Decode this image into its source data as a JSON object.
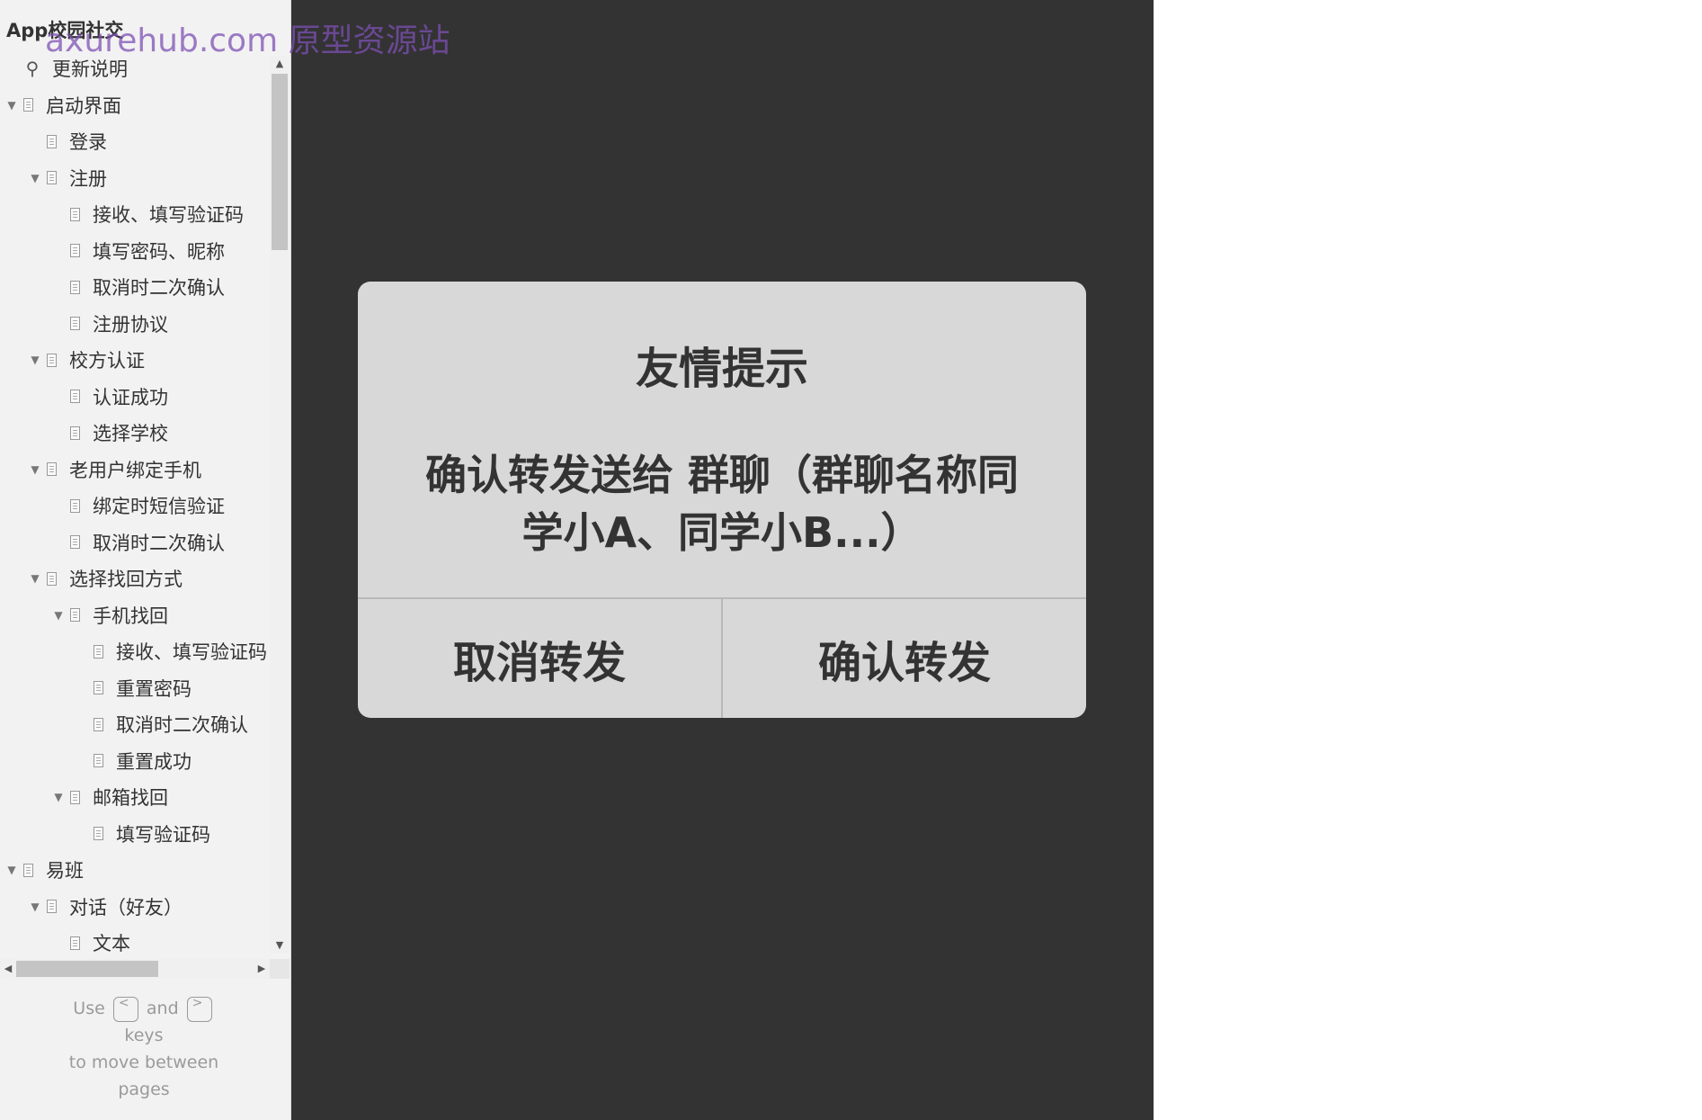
{
  "app": {
    "title": "App校园社交",
    "watermark": "axurehub.com 原型资源站"
  },
  "sidebar": {
    "items": [
      {
        "label": "更新说明",
        "level": 0,
        "expanded": null,
        "icon": "notes-icon"
      },
      {
        "label": "启动界面",
        "level": 0,
        "expanded": true,
        "icon": "page-icon"
      },
      {
        "label": "登录",
        "level": 1,
        "expanded": null,
        "icon": "page-icon"
      },
      {
        "label": "注册",
        "level": 1,
        "expanded": true,
        "icon": "page-icon"
      },
      {
        "label": "接收、填写验证码",
        "level": 2,
        "expanded": null,
        "icon": "page-icon"
      },
      {
        "label": "填写密码、昵称",
        "level": 2,
        "expanded": null,
        "icon": "page-icon"
      },
      {
        "label": "取消时二次确认",
        "level": 2,
        "expanded": null,
        "icon": "page-icon"
      },
      {
        "label": "注册协议",
        "level": 2,
        "expanded": null,
        "icon": "page-icon"
      },
      {
        "label": "校方认证",
        "level": 1,
        "expanded": true,
        "icon": "page-icon"
      },
      {
        "label": "认证成功",
        "level": 2,
        "expanded": null,
        "icon": "page-icon"
      },
      {
        "label": "选择学校",
        "level": 2,
        "expanded": null,
        "icon": "page-icon"
      },
      {
        "label": "老用户绑定手机",
        "level": 1,
        "expanded": true,
        "icon": "page-icon"
      },
      {
        "label": "绑定时短信验证",
        "level": 2,
        "expanded": null,
        "icon": "page-icon"
      },
      {
        "label": "取消时二次确认",
        "level": 2,
        "expanded": null,
        "icon": "page-icon"
      },
      {
        "label": "选择找回方式",
        "level": 1,
        "expanded": true,
        "icon": "page-icon"
      },
      {
        "label": "手机找回",
        "level": 2,
        "expanded": true,
        "icon": "page-icon"
      },
      {
        "label": "接收、填写验证码",
        "level": 3,
        "expanded": null,
        "icon": "page-icon"
      },
      {
        "label": "重置密码",
        "level": 3,
        "expanded": null,
        "icon": "page-icon"
      },
      {
        "label": "取消时二次确认",
        "level": 3,
        "expanded": null,
        "icon": "page-icon"
      },
      {
        "label": "重置成功",
        "level": 3,
        "expanded": null,
        "icon": "page-icon"
      },
      {
        "label": "邮箱找回",
        "level": 2,
        "expanded": true,
        "icon": "page-icon"
      },
      {
        "label": "填写验证码",
        "level": 3,
        "expanded": null,
        "icon": "page-icon"
      },
      {
        "label": "易班",
        "level": 0,
        "expanded": true,
        "icon": "page-icon"
      },
      {
        "label": "对话（好友）",
        "level": 1,
        "expanded": true,
        "icon": "page-icon"
      },
      {
        "label": "文本",
        "level": 2,
        "expanded": null,
        "icon": "page-icon"
      }
    ]
  },
  "hint": {
    "use": "Use",
    "prev_key": "<",
    "and": "and",
    "next_key": ">",
    "keys": "keys",
    "line2": "to move between",
    "line3": "pages"
  },
  "dialog": {
    "title": "友情提示",
    "message": "确认转发送给 群聊（群聊名称同学小A、同学小B...）",
    "cancel_label": "取消转发",
    "confirm_label": "确认转发"
  }
}
